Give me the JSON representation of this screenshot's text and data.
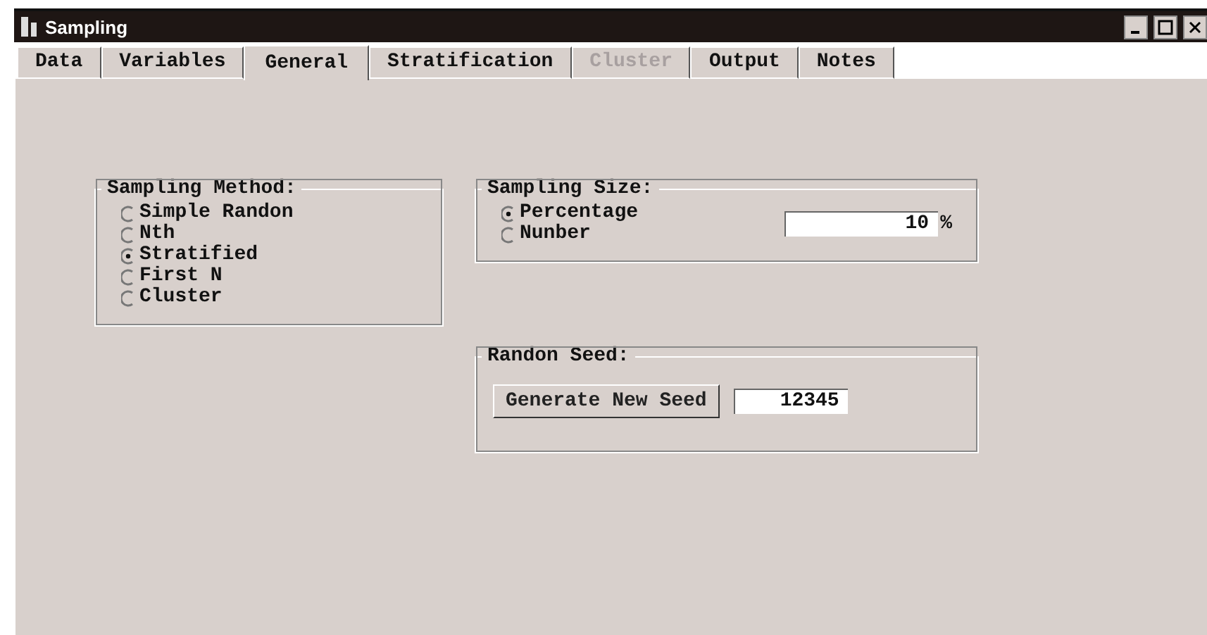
{
  "window": {
    "title": "Sampling"
  },
  "tabs": [
    {
      "label": "Data",
      "selected": false,
      "disabled": false
    },
    {
      "label": "Variables",
      "selected": false,
      "disabled": false
    },
    {
      "label": "General",
      "selected": true,
      "disabled": false
    },
    {
      "label": "Stratification",
      "selected": false,
      "disabled": false
    },
    {
      "label": "Cluster",
      "selected": false,
      "disabled": true
    },
    {
      "label": "Output",
      "selected": false,
      "disabled": false
    },
    {
      "label": "Notes",
      "selected": false,
      "disabled": false
    }
  ],
  "sampling_method": {
    "title": "Sampling Method:",
    "options": [
      {
        "label": "Simple Randon",
        "selected": false
      },
      {
        "label": "Nth",
        "selected": false
      },
      {
        "label": "Stratified",
        "selected": true
      },
      {
        "label": "First N",
        "selected": false
      },
      {
        "label": "Cluster",
        "selected": false
      }
    ]
  },
  "sampling_size": {
    "title": "Sampling Size:",
    "options": [
      {
        "label": "Percentage",
        "selected": true
      },
      {
        "label": "Nunber",
        "selected": false
      }
    ],
    "value": "10",
    "unit": "%"
  },
  "random_seed": {
    "title": "Randon Seed:",
    "button": "Generate New Seed",
    "value": "12345"
  }
}
